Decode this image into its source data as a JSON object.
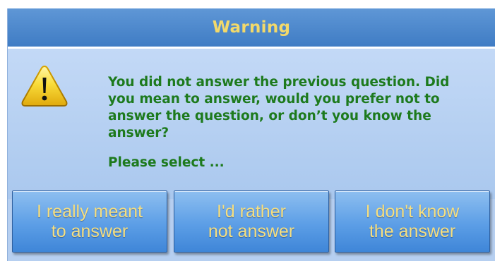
{
  "dialog": {
    "title": "Warning",
    "message": "You did not answer the previous question. Did you mean to answer, would you prefer not to answer the question, or don’t you know the answer?",
    "prompt": "Please select ...",
    "icon": "warning-icon"
  },
  "buttons": {
    "meant_to_answer": "I really meant\nto answer",
    "rather_not_answer": "I'd rather\nnot answer",
    "dont_know": "I don't know\nthe answer"
  },
  "colors": {
    "title_text": "#f3d96a",
    "message_text": "#1d7a1d",
    "button_text": "#f6df80",
    "title_bar": "#4a86cc",
    "background": "#b6cff0"
  }
}
